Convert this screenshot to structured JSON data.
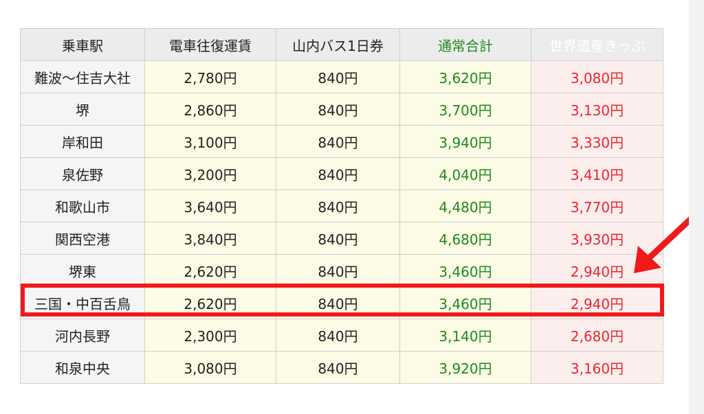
{
  "table": {
    "headers": [
      "乗車駅",
      "電車往復運賃",
      "山内バス1日券",
      "通常合計",
      "世界遺産きっぷ"
    ],
    "rows": [
      [
        "難波〜住吉大社",
        "2,780円",
        "840円",
        "3,620円",
        "3,080円"
      ],
      [
        "堺",
        "2,860円",
        "840円",
        "3,700円",
        "3,130円"
      ],
      [
        "岸和田",
        "3,100円",
        "840円",
        "3,940円",
        "3,330円"
      ],
      [
        "泉佐野",
        "3,200円",
        "840円",
        "4,040円",
        "3,410円"
      ],
      [
        "和歌山市",
        "3,640円",
        "840円",
        "4,480円",
        "3,770円"
      ],
      [
        "関西空港",
        "3,840円",
        "840円",
        "4,680円",
        "3,930円"
      ],
      [
        "堺東",
        "2,620円",
        "840円",
        "3,460円",
        "2,940円"
      ],
      [
        "三国・中百舌鳥",
        "2,620円",
        "840円",
        "3,460円",
        "2,940円"
      ],
      [
        "河内長野",
        "2,300円",
        "840円",
        "3,140円",
        "2,680円"
      ],
      [
        "和泉中央",
        "3,080円",
        "840円",
        "3,920円",
        "3,160円"
      ]
    ],
    "highlighted_row": 7
  },
  "colors": {
    "normal_total": "#1d8a1d",
    "heritage_ticket": "#e8262b",
    "heritage_header_bg": "#e06666",
    "highlight_border": "#f01a1a",
    "arrow": "#f01a1a"
  },
  "icons": {
    "annotation": "arrow-icon"
  }
}
